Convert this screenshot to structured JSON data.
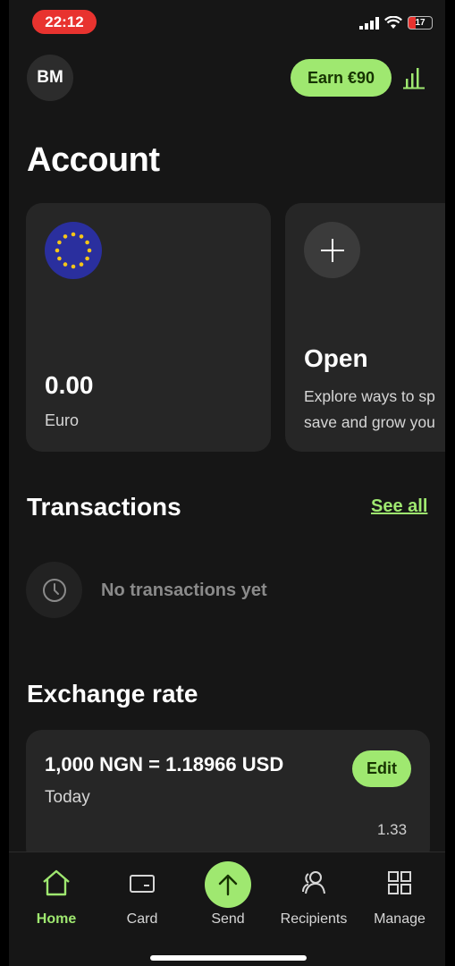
{
  "status_bar": {
    "time": "22:12",
    "battery": "17"
  },
  "header": {
    "avatar_initials": "BM",
    "earn_label": "Earn €90"
  },
  "page": {
    "title": "Account"
  },
  "accounts": [
    {
      "balance": "0.00",
      "currency": "Euro",
      "icon": "eu-flag-icon"
    },
    {
      "title": "Open",
      "description_line1": "Explore ways to sp",
      "description_line2": "save and grow you",
      "icon": "plus-icon"
    }
  ],
  "transactions": {
    "title": "Transactions",
    "see_all": "See all",
    "empty_text": "No transactions yet"
  },
  "exchange": {
    "title": "Exchange rate",
    "rate": "1,000 NGN = 1.18966 USD",
    "period": "Today",
    "edit_label": "Edit",
    "value": "1.33"
  },
  "nav": [
    {
      "label": "Home",
      "icon": "home-icon",
      "active": true
    },
    {
      "label": "Card",
      "icon": "card-icon"
    },
    {
      "label": "Send",
      "icon": "arrow-up-icon"
    },
    {
      "label": "Recipients",
      "icon": "recipients-icon"
    },
    {
      "label": "Manage",
      "icon": "grid-icon"
    }
  ],
  "colors": {
    "accent": "#9fe870",
    "accent_text": "#163300",
    "background": "#161616",
    "card": "#262626",
    "status_time_bg": "#e8332f"
  }
}
